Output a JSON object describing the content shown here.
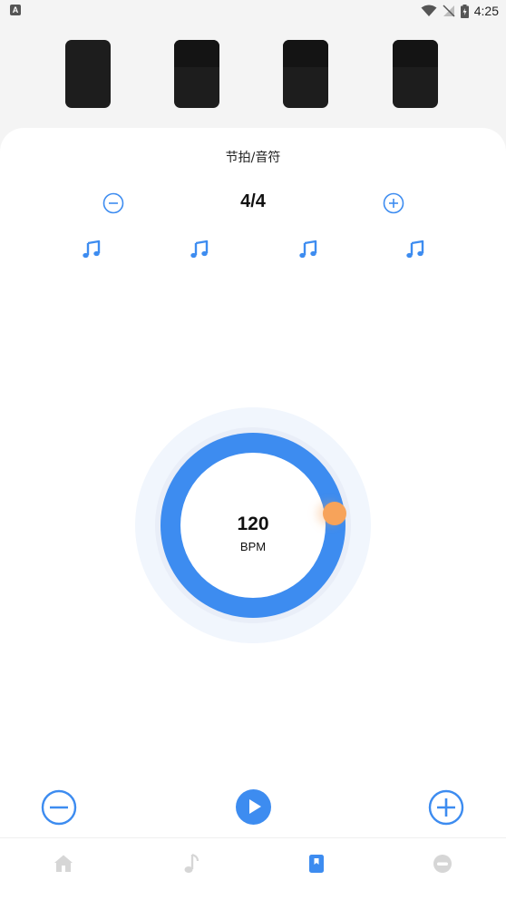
{
  "status_bar": {
    "app_badge": "A",
    "time": "4:25",
    "icons": [
      "wifi-icon",
      "signal-off-icon",
      "battery-charging-icon"
    ]
  },
  "beats": [
    {
      "name": "beat-1",
      "accent": true
    },
    {
      "name": "beat-2",
      "accent": false
    },
    {
      "name": "beat-3",
      "accent": false
    },
    {
      "name": "beat-4",
      "accent": false
    }
  ],
  "meter": {
    "title": "节拍/音符",
    "time_signature": "4/4",
    "decrease_icon": "minus-circle-icon",
    "increase_icon": "plus-circle-icon",
    "notes": [
      "music-note-icon",
      "music-note-icon",
      "music-note-icon",
      "music-note-icon"
    ]
  },
  "tempo": {
    "bpm": "120",
    "unit": "BPM"
  },
  "controls": {
    "decrease_icon": "minus-circle-icon",
    "play_icon": "play-icon",
    "increase_icon": "plus-circle-icon"
  },
  "nav": {
    "items": [
      "home-icon",
      "music-note-icon",
      "bookmark-icon",
      "profile-icon"
    ],
    "active_index": 2
  },
  "colors": {
    "accent": "#3d8cf0",
    "knob": "#f7a35a",
    "inactive_nav": "#d6d6d6",
    "block": "#1d1d1d"
  }
}
